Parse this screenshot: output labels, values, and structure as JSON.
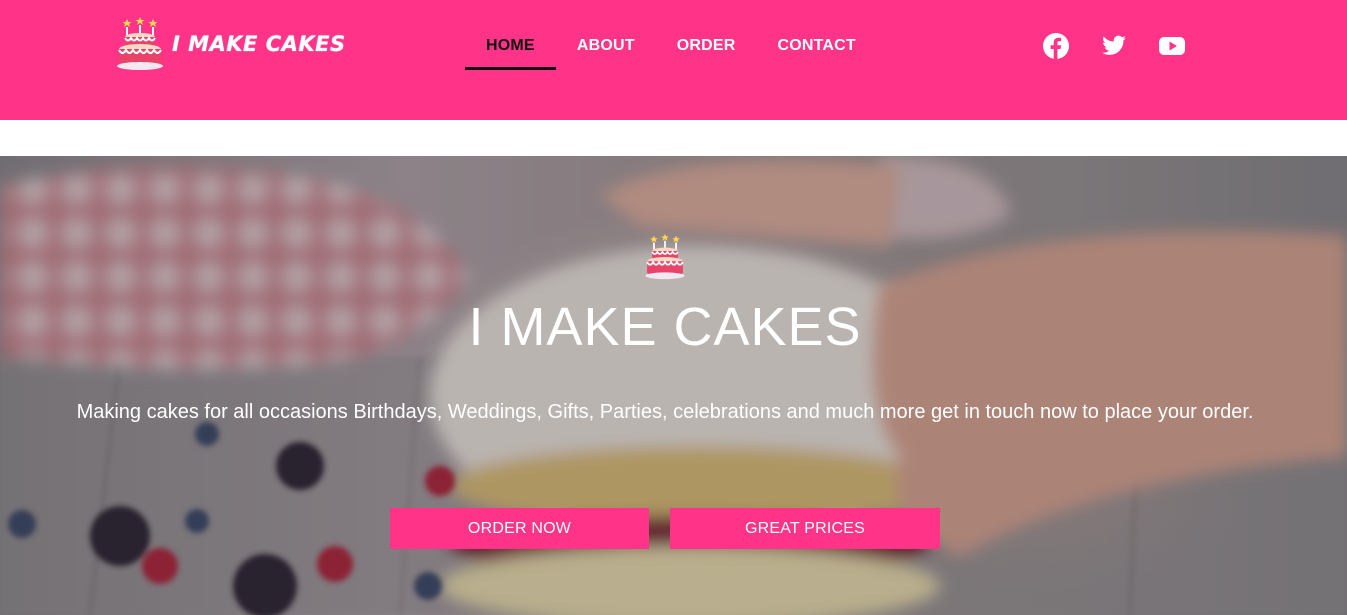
{
  "brand": {
    "name": "I MAKE CAKES",
    "accent_color": "#ff3388",
    "logo_icon": "birthday-cake-icon"
  },
  "nav": {
    "items": [
      {
        "label": "HOME",
        "active": true
      },
      {
        "label": "ABOUT",
        "active": false
      },
      {
        "label": "ORDER",
        "active": false
      },
      {
        "label": "CONTACT",
        "active": false
      }
    ]
  },
  "social": [
    {
      "icon": "facebook-icon"
    },
    {
      "icon": "twitter-icon"
    },
    {
      "icon": "youtube-icon"
    }
  ],
  "hero": {
    "icon": "birthday-cake-icon",
    "title": "I MAKE CAKES",
    "text": "Making cakes for all occasions Birthdays, Weddings, Gifts, Parties, celebrations and much more get in touch now to place your order.",
    "buttons": {
      "primary": "ORDER NOW",
      "secondary": "GREAT PRICES"
    }
  }
}
